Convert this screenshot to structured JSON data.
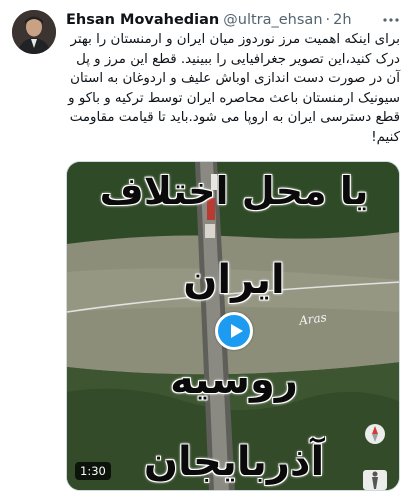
{
  "author": {
    "name": "Ehsan Movahedian",
    "handle": "@ultra_ehsan",
    "separator": "·",
    "time": "2h"
  },
  "tweet": {
    "lines": [
      "برای اینکه اهمیت مرز نوردوز میان ایران و ارمنستان را بهتر",
      "درک کنید،این تصویر جغرافیایی را ببینید. قطع این مرز و پل",
      "آن در صورت دست اندازی اوباش علیف و اردوغان به استان",
      "سیونیک ارمنستان باعث محاصره ایران توسط ترکیه و باکو و",
      "قطع دسترسی ایران به اروپا می شود.باید تا قیامت مقاومت",
      "کنیم!"
    ]
  },
  "media": {
    "overlay_lines": [
      "یا محل اختلاف",
      "ایران",
      "روسیه",
      "آذربایجان"
    ],
    "river_label": "Aras",
    "duration": "1:30"
  },
  "colors": {
    "accent": "#1d9bf0",
    "text": "#0f1419",
    "secondary": "#536471"
  },
  "icons": {
    "more": "more-dots-icon",
    "play": "play-icon",
    "compass": "compass-icon",
    "pegman": "pegman-icon"
  }
}
